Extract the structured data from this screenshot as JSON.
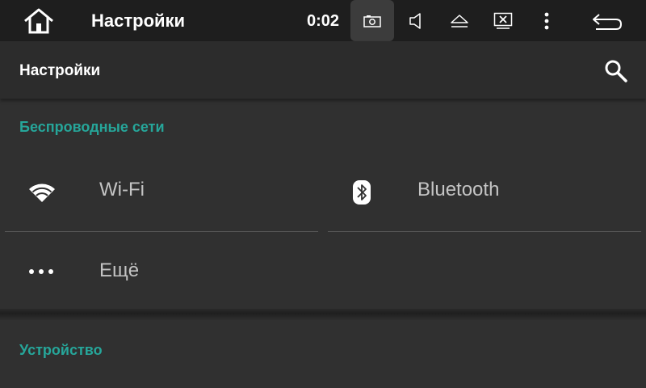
{
  "statusbar": {
    "title": "Настройки",
    "time": "0:02",
    "icons": [
      "home-icon",
      "screenshot-icon",
      "volume-icon",
      "eject-icon",
      "display-off-icon",
      "more-vert-icon",
      "back-icon"
    ]
  },
  "appbar": {
    "title": "Настройки",
    "search_icon": "search-icon"
  },
  "sections": {
    "wireless": {
      "title": "Беспроводные сети",
      "items": {
        "wifi": {
          "label": "Wi-Fi",
          "icon": "wifi-icon"
        },
        "bluetooth": {
          "label": "Bluetooth",
          "icon": "bluetooth-icon"
        },
        "more": {
          "label": "Ещё",
          "icon": "more-horiz-icon"
        }
      }
    },
    "device": {
      "title": "Устройство"
    }
  },
  "colors": {
    "accent": "#26a69a",
    "background": "#303030",
    "statusbar": "#1e1e1e",
    "appbar": "#2c2c2c",
    "item_text": "#c4c4c4"
  }
}
